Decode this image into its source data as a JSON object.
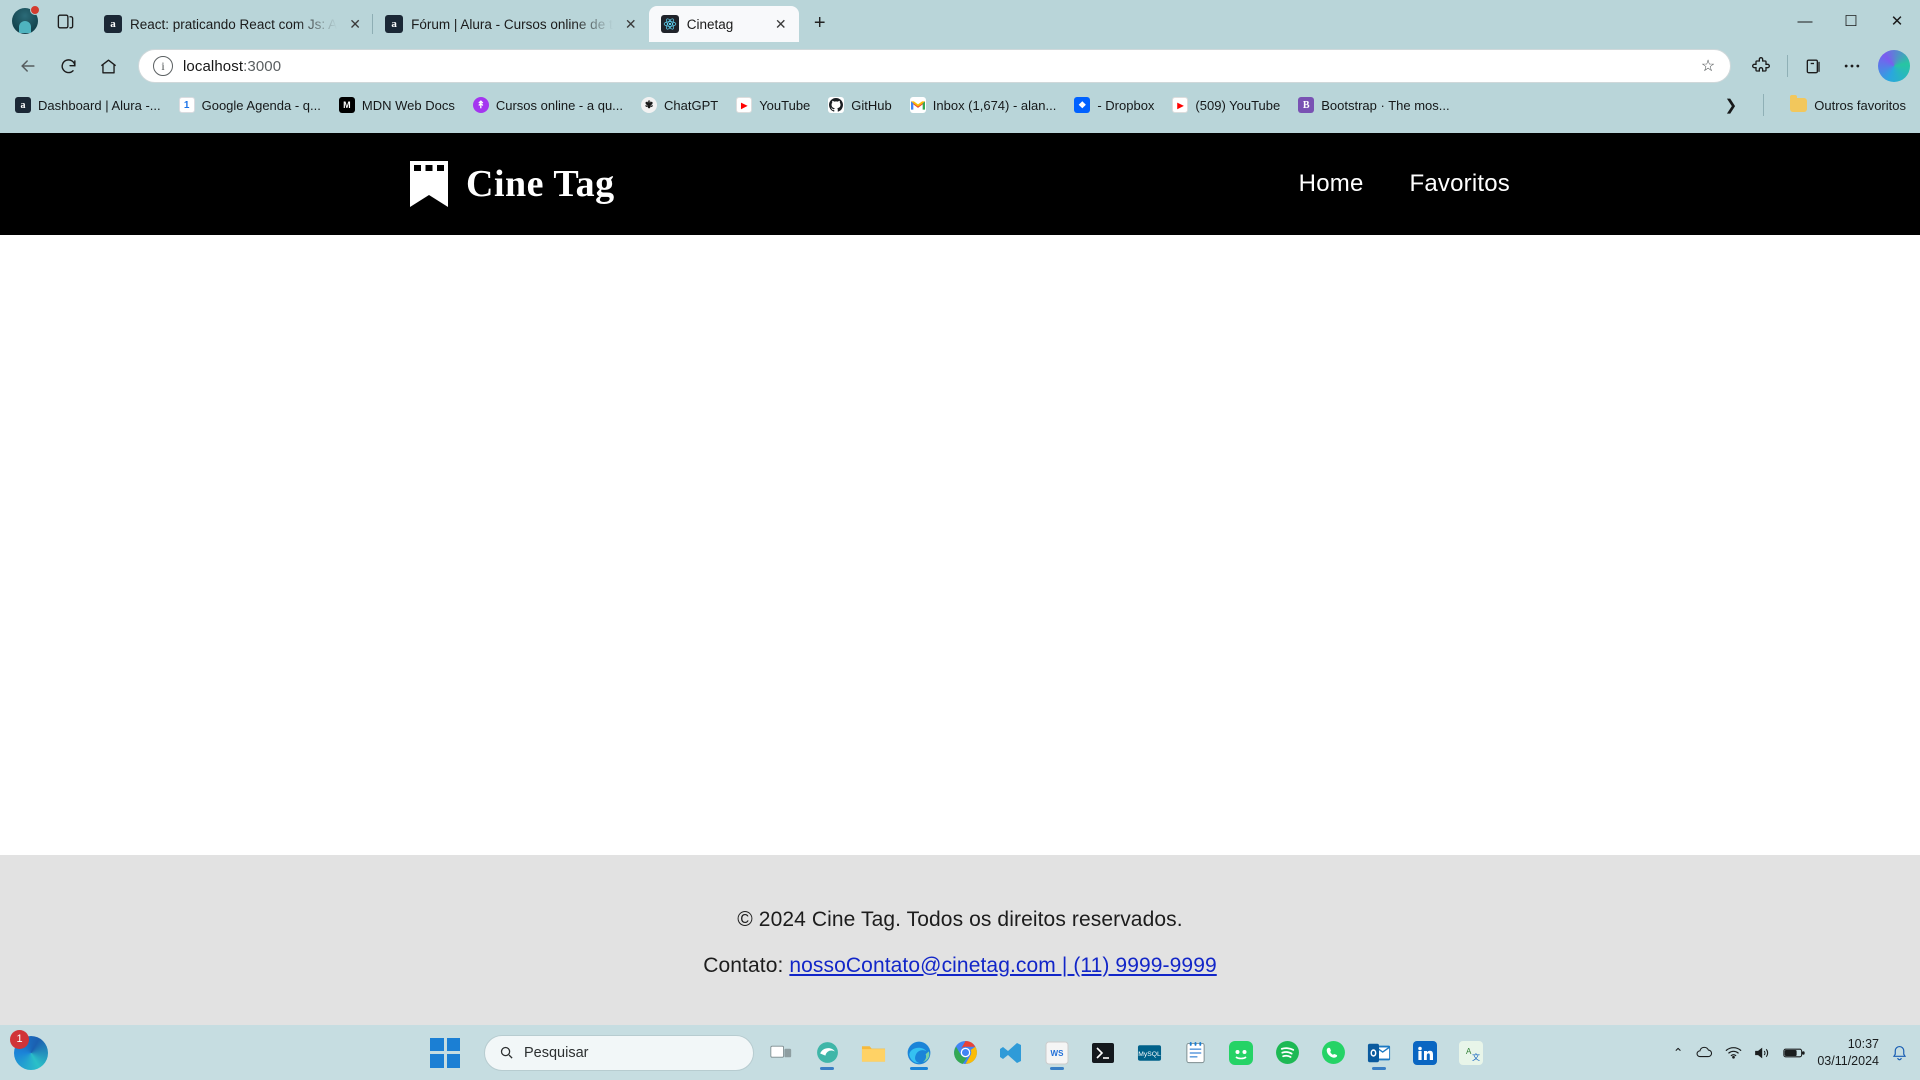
{
  "browser": {
    "tabs": [
      {
        "title": "React: praticando React com Js: A",
        "favicon": "alura-icon",
        "active": false
      },
      {
        "title": "Fórum | Alura - Cursos online de t",
        "favicon": "alura-icon",
        "active": false
      },
      {
        "title": "Cinetag",
        "favicon": "react-icon",
        "active": true
      }
    ],
    "new_tab_label": "+",
    "window_controls": {
      "minimize": "—",
      "maximize": "☐",
      "close": "✕"
    },
    "toolbar": {
      "back_icon": "back-arrow-icon",
      "reload_icon": "reload-icon",
      "home_icon": "home-icon",
      "url_scheme": "",
      "url_host": "localhost",
      "url_port": ":3000",
      "url_full": "localhost:3000",
      "info_icon": "info-icon",
      "favorite_icon": "star-icon",
      "extensions_icon": "extensions-icon",
      "collections_icon": "collections-icon",
      "settings_icon": "more-options-icon",
      "copilot_icon": "copilot-icon"
    },
    "bookmarks": [
      {
        "label": "Dashboard | Alura -...",
        "icon": "alura-favicon",
        "color": "#1b2836"
      },
      {
        "label": "Google Agenda - q...",
        "icon": "google-calendar-favicon",
        "color": "#1a73e8"
      },
      {
        "label": "MDN Web Docs",
        "icon": "mdn-favicon",
        "color": "#000000"
      },
      {
        "label": "Cursos online - a qu...",
        "icon": "alura-circle-favicon",
        "color": "#a435f0"
      },
      {
        "label": "ChatGPT",
        "icon": "chatgpt-favicon",
        "color": "#6e6e6e"
      },
      {
        "label": "YouTube",
        "icon": "youtube-favicon",
        "color": "#ff0000"
      },
      {
        "label": "GitHub",
        "icon": "github-favicon",
        "color": "#1b1f23"
      },
      {
        "label": "Inbox (1,674) - alan...",
        "icon": "gmail-favicon",
        "color": "#ea4335"
      },
      {
        "label": "- Dropbox",
        "icon": "dropbox-favicon",
        "color": "#0061ff"
      },
      {
        "label": "(509) YouTube",
        "icon": "youtube-favicon",
        "color": "#ff0000"
      },
      {
        "label": "Bootstrap · The mos...",
        "icon": "bootstrap-favicon",
        "color": "#7952b3"
      }
    ],
    "bookmarks_overflow_icon": "chevron-right-icon",
    "other_favorites": {
      "label": "Outros favoritos",
      "icon": "folder-icon"
    }
  },
  "page": {
    "header": {
      "logo_text": "Cine Tag",
      "logo_icon": "film-bookmark-icon",
      "nav": [
        {
          "label": "Home"
        },
        {
          "label": "Favoritos"
        }
      ]
    },
    "content": {
      "empty": ""
    },
    "footer": {
      "copyright": "© 2024 Cine Tag. Todos os direitos reservados.",
      "contact_label": "Contato:",
      "contact_link": "nossoContato@cinetag.com | (11) 9999-9999",
      "background": "#e2e2e2",
      "link_color": "#1226c8"
    },
    "header_background": "#000000"
  },
  "taskbar": {
    "pinned_edge": {
      "icon": "edge-icon",
      "badge": "1"
    },
    "start_icon": "windows-start-icon",
    "search": {
      "placeholder": "Pesquisar",
      "icon": "search-icon"
    },
    "items": [
      {
        "name": "task-view-icon"
      },
      {
        "name": "edge-dev-icon"
      },
      {
        "name": "file-explorer-icon"
      },
      {
        "name": "microsoft-edge-icon",
        "active": true
      },
      {
        "name": "google-chrome-icon"
      },
      {
        "name": "vs-code-icon"
      },
      {
        "name": "webstorm-icon"
      },
      {
        "name": "powershell-icon"
      },
      {
        "name": "mysql-workbench-icon"
      },
      {
        "name": "notepad-icon"
      },
      {
        "name": "whatsapp-green-icon"
      },
      {
        "name": "spotify-icon"
      },
      {
        "name": "whatsapp-icon"
      },
      {
        "name": "outlook-icon"
      },
      {
        "name": "linkedin-icon"
      },
      {
        "name": "translator-icon"
      }
    ],
    "tray": {
      "overflow_icon": "chevron-up-icon",
      "onedrive_icon": "cloud-icon",
      "wifi_icon": "wifi-icon",
      "volume_icon": "speaker-icon",
      "battery_icon": "battery-icon",
      "notification_icon": "bell-icon"
    },
    "clock": {
      "time": "10:37",
      "date": "03/11/2024"
    }
  }
}
